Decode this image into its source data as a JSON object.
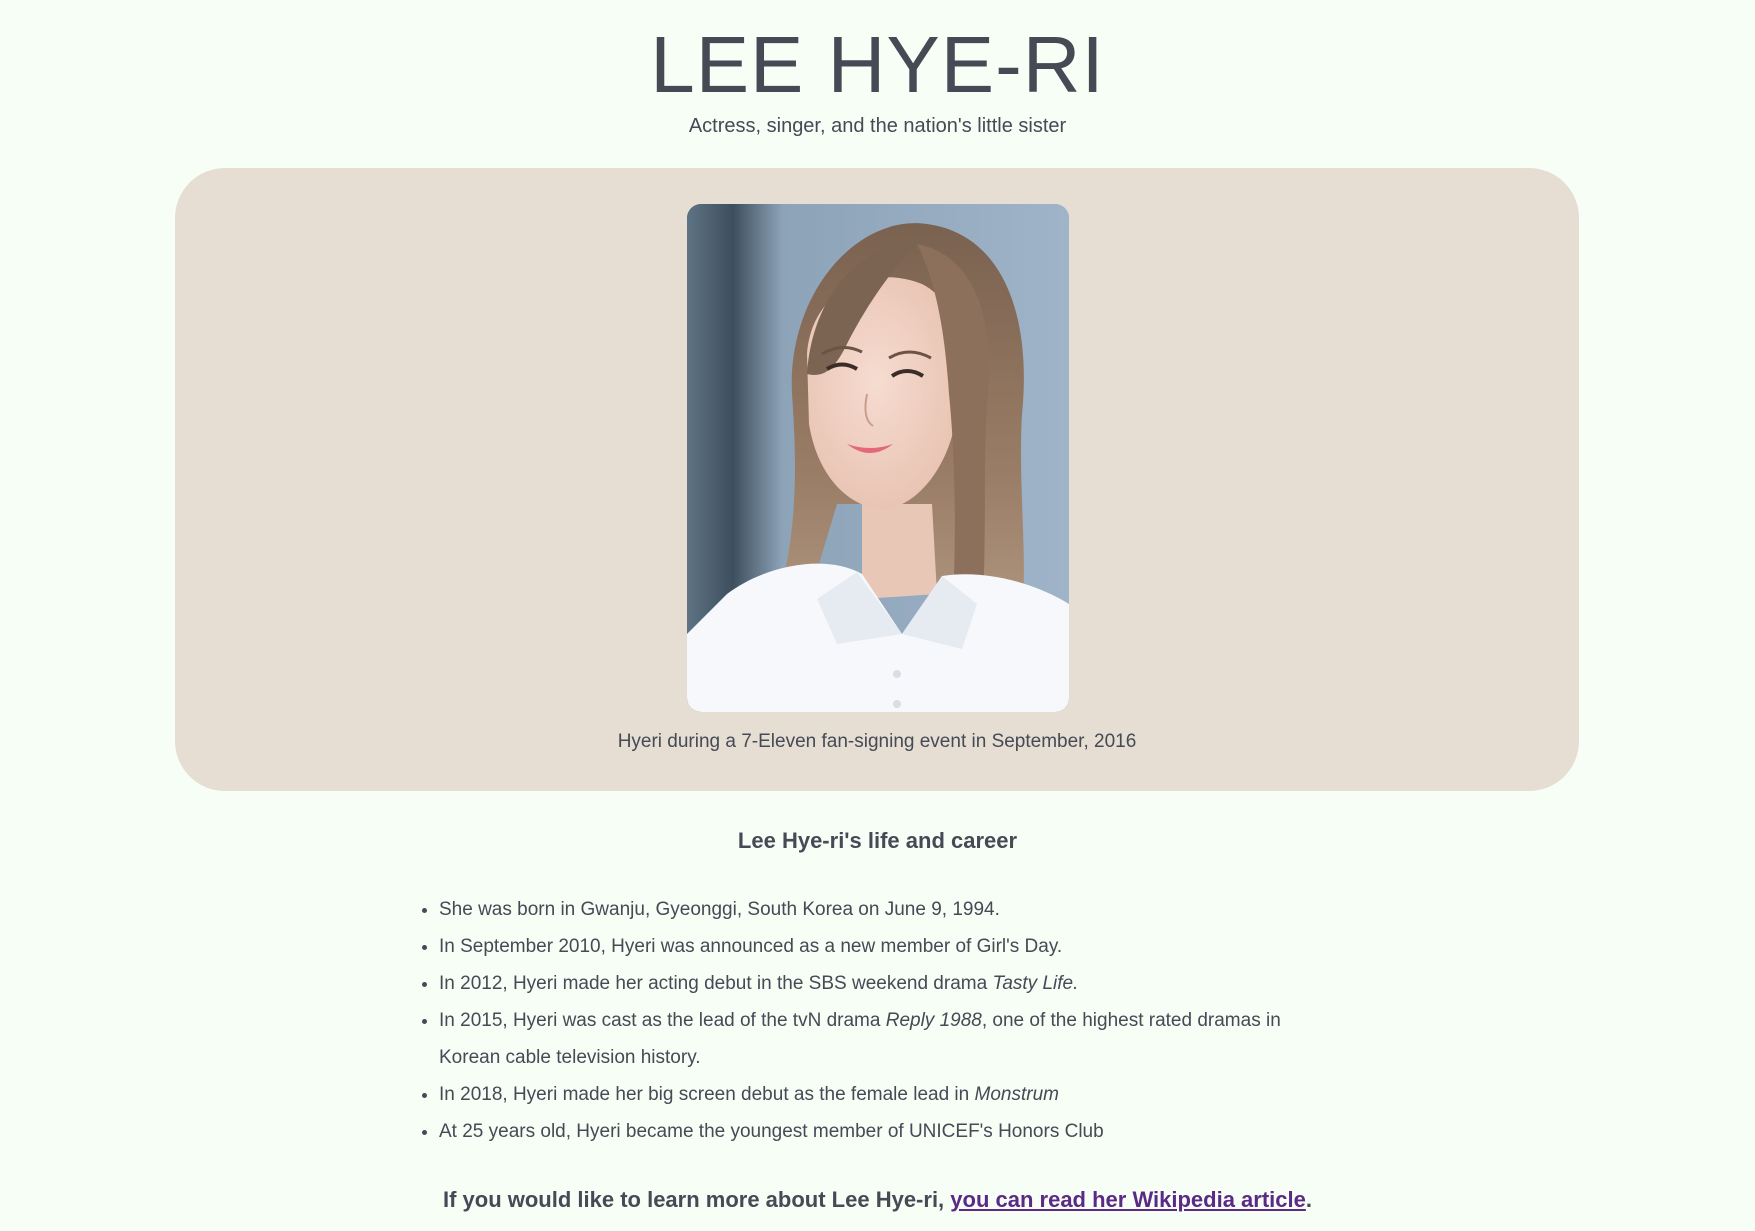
{
  "header": {
    "title": "LEE HYE-RI",
    "subtitle": "Actress, singer, and the nation's little sister"
  },
  "photo": {
    "alt": "Hyeri during a 7-Eleven fan-signing event",
    "caption": "Hyeri during a 7-Eleven fan-signing event in September, 2016"
  },
  "section": {
    "heading": "Lee Hye-ri's life and career"
  },
  "facts": [
    {
      "text": "She was born in Gwanju, Gyeonggi, South Korea on June 9, 1994.",
      "title": "",
      "after": ""
    },
    {
      "text": "In September 2010, Hyeri was announced as a new member of Girl's Day.",
      "title": "",
      "after": ""
    },
    {
      "text": "In 2012, Hyeri made her acting debut in the SBS weekend drama ",
      "title": "Tasty Life.",
      "after": ""
    },
    {
      "text": "In 2015, Hyeri was cast as the lead of the tvN drama ",
      "title": "Reply 1988",
      "after": ", one of the highest rated dramas in Korean cable television history."
    },
    {
      "text": "In 2018, Hyeri made her big screen debut as the female lead in ",
      "title": "Monstrum",
      "after": ""
    },
    {
      "text": "At 25 years old, Hyeri became the youngest member of UNICEF's Honors Club",
      "title": "",
      "after": ""
    }
  ],
  "outro": {
    "text": "If you would like to learn more about Lee Hye-ri, ",
    "link_text": "you can read her Wikipedia article",
    "end": "."
  },
  "colors": {
    "background": "#f6fef6",
    "card": "#e6ddd3",
    "text": "#454a55",
    "link": "#5b2a86"
  }
}
